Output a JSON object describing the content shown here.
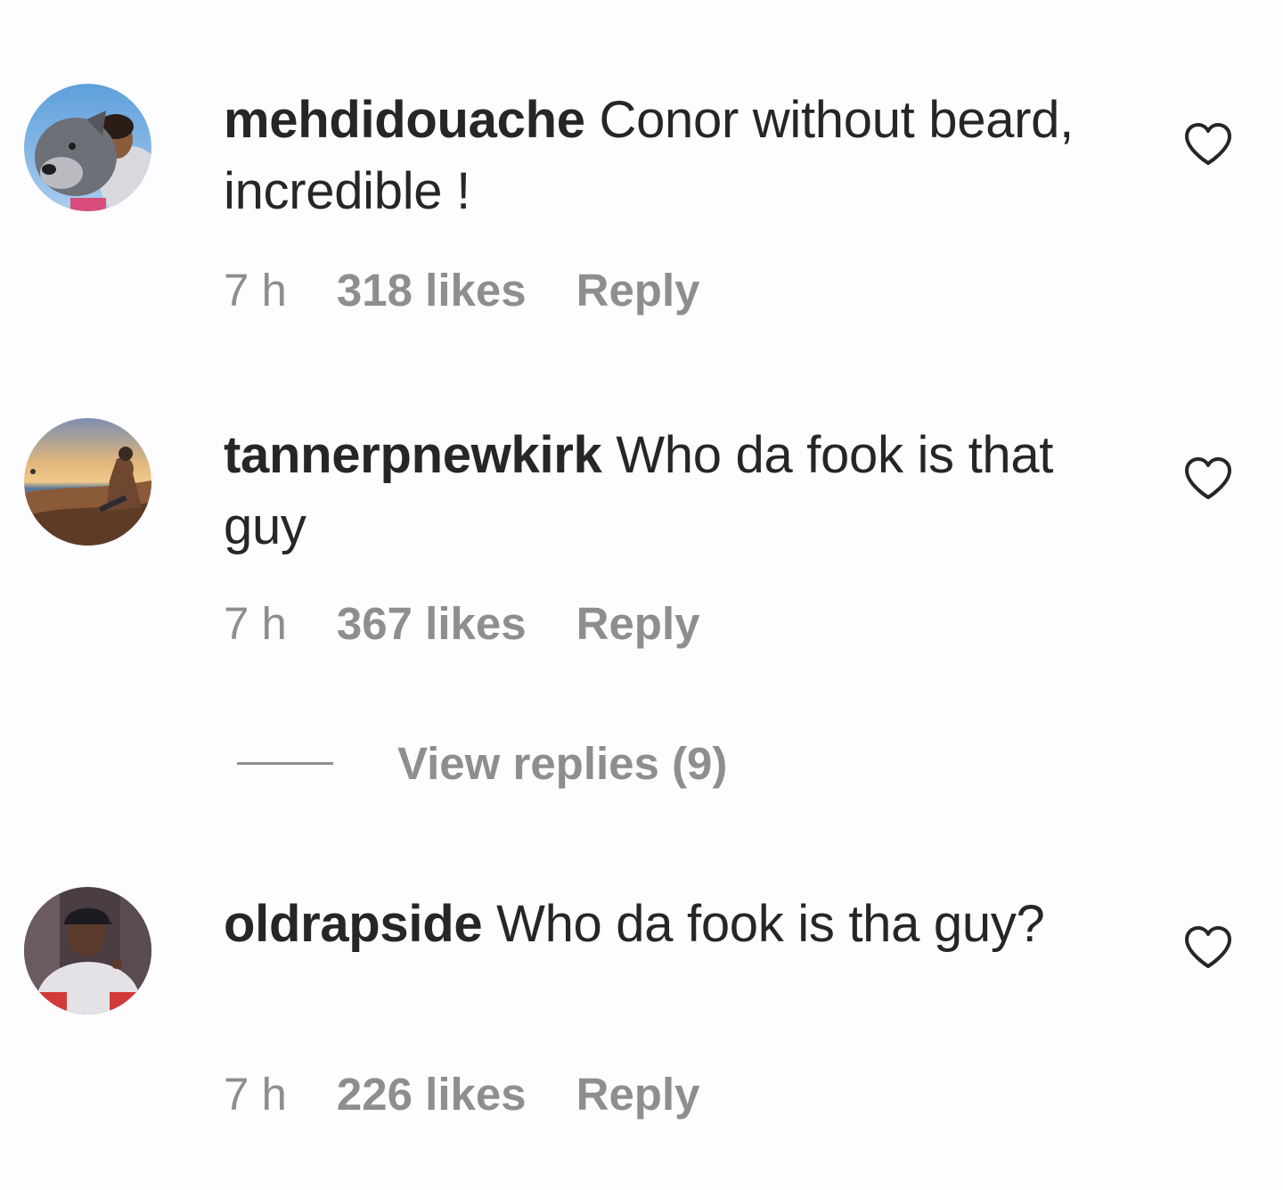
{
  "comments": [
    {
      "username": "mehdidouache",
      "text": "Conor without beard, incredible !",
      "time": "7 h",
      "likes": "318 likes",
      "reply": "Reply",
      "avatar_icon": "avatar-dog-and-man"
    },
    {
      "username": "tannerpnewkirk",
      "text": "Who da fook is that guy",
      "time": "7 h",
      "likes": "367 likes",
      "reply": "Reply",
      "avatar_icon": "avatar-sunset-beach"
    },
    {
      "username": "oldrapside",
      "text": "Who da fook is tha guy?",
      "time": "7 h",
      "likes": "226 likes",
      "reply": "Reply",
      "avatar_icon": "avatar-man-in-cap"
    }
  ],
  "view_replies": {
    "label": "View replies (9)"
  },
  "icons": {
    "like": "heart-outline-icon"
  },
  "colors": {
    "text": "#262626",
    "secondary": "#8e8e8e",
    "background": "#fdfcfe"
  }
}
